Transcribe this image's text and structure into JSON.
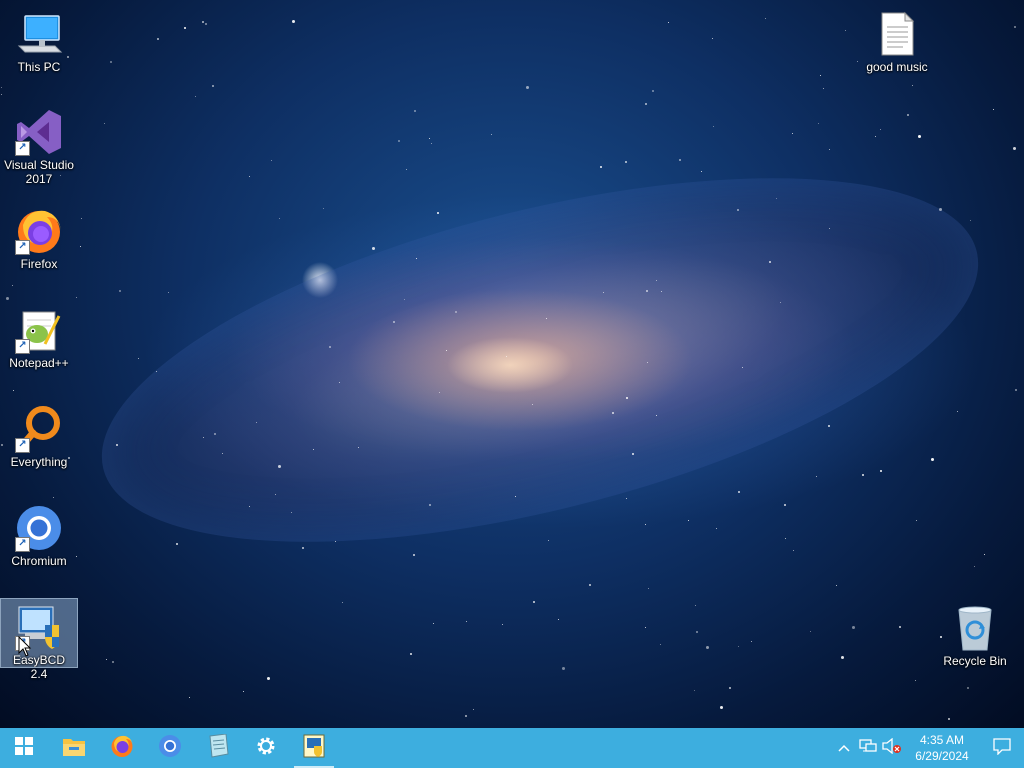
{
  "desktop": {
    "icons": [
      {
        "label": "This PC",
        "icon": "computer-icon",
        "shortcut": false,
        "selected": false
      },
      {
        "label": "Visual Studio 2017",
        "icon": "visual-studio-icon",
        "shortcut": true,
        "selected": false
      },
      {
        "label": "Firefox",
        "icon": "firefox-icon",
        "shortcut": true,
        "selected": false
      },
      {
        "label": "Notepad++",
        "icon": "notepadpp-icon",
        "shortcut": true,
        "selected": false
      },
      {
        "label": "Everything",
        "icon": "everything-search-icon",
        "shortcut": true,
        "selected": false
      },
      {
        "label": "Chromium",
        "icon": "chromium-icon",
        "shortcut": true,
        "selected": false
      },
      {
        "label": "EasyBCD 2.4",
        "icon": "easybcd-icon",
        "shortcut": true,
        "selected": true
      },
      {
        "label": "good music",
        "icon": "text-file-icon",
        "shortcut": false,
        "selected": false
      },
      {
        "label": "Recycle Bin",
        "icon": "recycle-bin-icon",
        "shortcut": false,
        "selected": false
      }
    ]
  },
  "taskbar": {
    "start_icon": "windows-start-icon",
    "pinned": [
      {
        "icon": "file-explorer-icon"
      },
      {
        "icon": "firefox-icon"
      },
      {
        "icon": "chromium-icon"
      },
      {
        "icon": "notepad-icon"
      },
      {
        "icon": "settings-gear-icon"
      },
      {
        "icon": "easybcd-icon"
      }
    ],
    "tray": {
      "icons": [
        "chevron-up-icon",
        "network-icon",
        "volume-muted-icon"
      ],
      "time": "4:35 AM",
      "date": "6/29/2024",
      "notification_icon": "action-center-icon"
    }
  },
  "colors": {
    "taskbar": "#3daedf",
    "selection": "#aacdf0"
  }
}
